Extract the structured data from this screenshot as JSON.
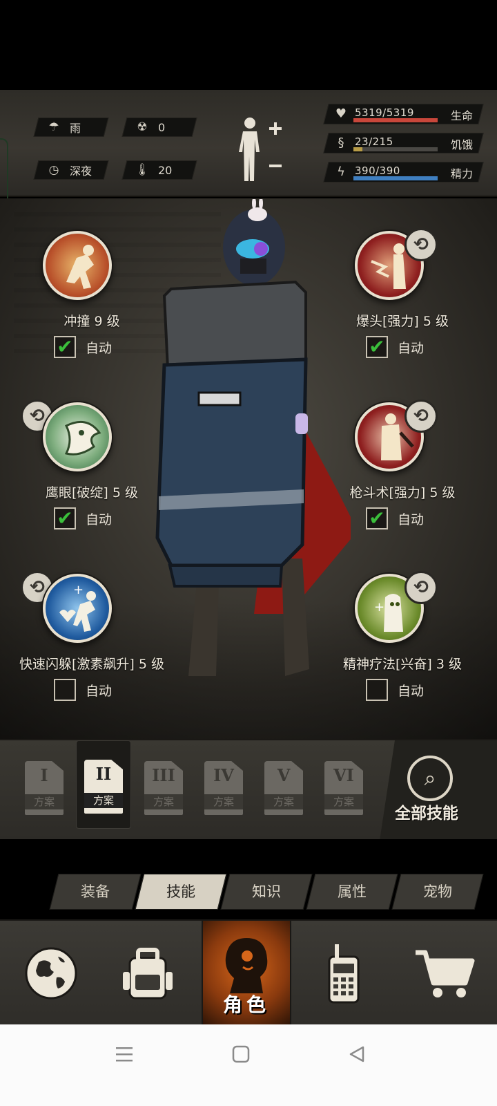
{
  "status": {
    "weather": "雨",
    "radiation": "0",
    "time_of_day": "深夜",
    "temperature": "20",
    "stats": [
      {
        "icon": "heart-icon",
        "value": "5319/5319",
        "label": "生命",
        "fraction": 1.0,
        "color": "#c9473b"
      },
      {
        "icon": "stomach-icon",
        "value": "23/215",
        "label": "饥饿",
        "fraction": 0.107,
        "color": "#b89c47"
      },
      {
        "icon": "energy-icon",
        "value": "390/390",
        "label": "精力",
        "fraction": 1.0,
        "color": "#3f7fc0"
      }
    ]
  },
  "skills": [
    {
      "name": "冲撞 9 级",
      "auto_label": "自动",
      "auto": true,
      "swappable": false,
      "color": "#b8502a"
    },
    {
      "name": "爆头[强力] 5 级",
      "auto_label": "自动",
      "auto": true,
      "swappable": true,
      "color": "#8e1f1f"
    },
    {
      "name": "鹰眼[破绽] 5 级",
      "auto_label": "自动",
      "auto": true,
      "swappable": true,
      "color": "#3d7a4a"
    },
    {
      "name": "枪斗术[强力] 5 级",
      "auto_label": "自动",
      "auto": true,
      "swappable": true,
      "color": "#8e1f1f"
    },
    {
      "name": "快速闪躲[激素飙升] 5 级",
      "auto_label": "自动",
      "auto": false,
      "swappable": true,
      "color": "#1f5a9e"
    },
    {
      "name": "精神疗法[兴奋] 3 级",
      "auto_label": "自动",
      "auto": false,
      "swappable": true,
      "color": "#6a8a2a"
    }
  ],
  "plans": {
    "items": [
      {
        "roman": "I",
        "label": "方案"
      },
      {
        "roman": "II",
        "label": "方案"
      },
      {
        "roman": "III",
        "label": "方案"
      },
      {
        "roman": "IV",
        "label": "方案"
      },
      {
        "roman": "V",
        "label": "方案"
      },
      {
        "roman": "VI",
        "label": "方案"
      }
    ],
    "active_index": 1,
    "all_skills_label": "全部技能"
  },
  "tabs": {
    "items": [
      "装备",
      "技能",
      "知识",
      "属性",
      "宠物"
    ],
    "active_index": 1
  },
  "nav": {
    "items": [
      "world-icon",
      "backpack-icon",
      "character-icon",
      "radio-icon",
      "cart-icon"
    ],
    "active_label": "角色"
  }
}
